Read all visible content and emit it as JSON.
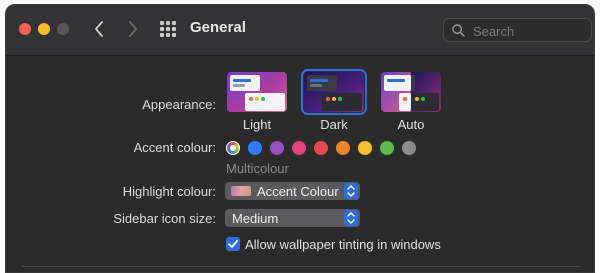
{
  "window": {
    "title": "General"
  },
  "search": {
    "placeholder": "Search"
  },
  "appearance": {
    "label": "Appearance:",
    "options": [
      {
        "label": "Light",
        "selected": false
      },
      {
        "label": "Dark",
        "selected": true
      },
      {
        "label": "Auto",
        "selected": false
      }
    ]
  },
  "accent": {
    "label": "Accent colour:",
    "selected_name": "Multicolour",
    "colors": [
      "multicolour",
      "#2e7cf6",
      "#9b4fbf",
      "#e0427f",
      "#e5484d",
      "#f0832e",
      "#f5c02e",
      "#5fbb49",
      "#8c8c8c"
    ]
  },
  "highlight": {
    "label": "Highlight colour:",
    "value": "Accent Colour"
  },
  "sidebar_icon_size": {
    "label": "Sidebar icon size:",
    "value": "Medium"
  },
  "wallpaper_tinting": {
    "label": "Allow wallpaper tinting in windows",
    "checked": true
  }
}
